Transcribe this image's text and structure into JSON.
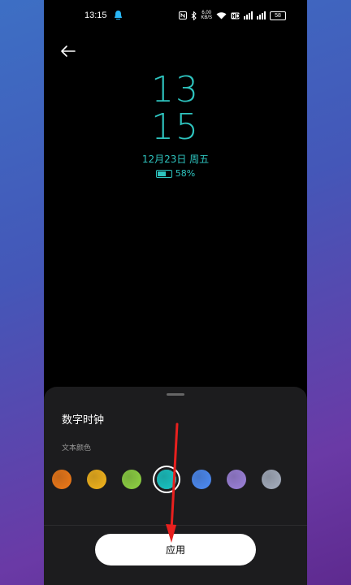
{
  "status_bar": {
    "time": "13:15",
    "net_speed_value": "6.00",
    "net_speed_unit": "KB/S",
    "battery": "58"
  },
  "clock": {
    "hour": "13",
    "minute": "15",
    "date": "12月23日 周五",
    "battery_percent": "58%"
  },
  "sheet": {
    "title": "数字时钟",
    "subtitle": "文本颜色",
    "apply_label": "应用",
    "swatch_colors": [
      "#f07a18",
      "#f4b51c",
      "#8fd443",
      "#18c7c6",
      "#4d8cf6",
      "#9d82db",
      "#a6afbf"
    ],
    "selected_index": 3
  },
  "colors": {
    "clock_accent": "#2ec4bf",
    "annotation_arrow": "#e8201e"
  }
}
